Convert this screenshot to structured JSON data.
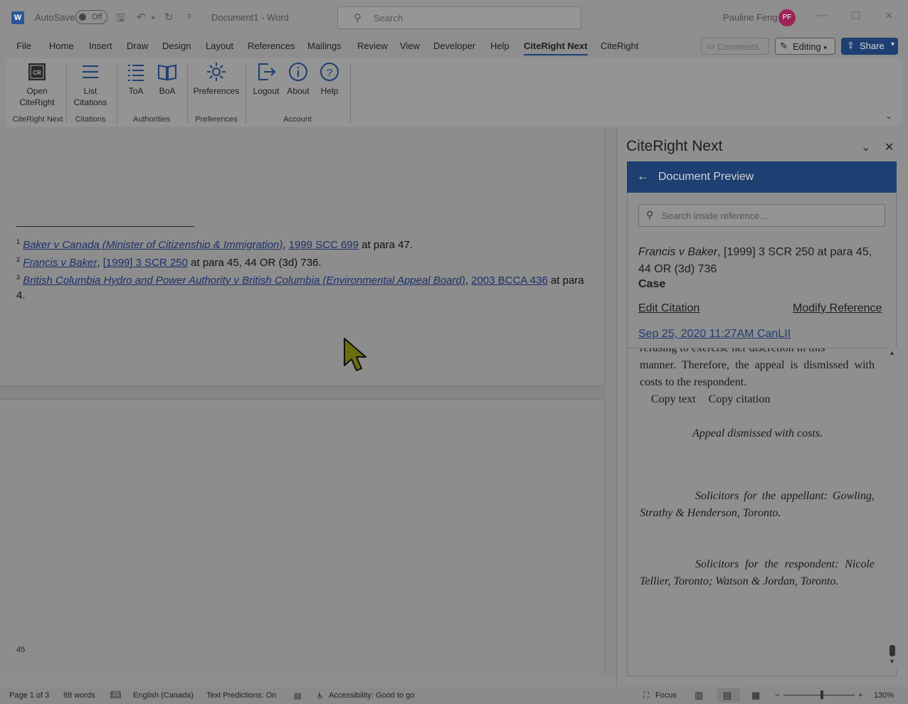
{
  "titlebar": {
    "app_logo": "W",
    "autosave_label": "AutoSave",
    "autosave_state": "Off",
    "doc_title": "Document1  -  Word",
    "search_placeholder": "Search",
    "user_name": "Pauline Feng",
    "user_initials": "PF",
    "icons": [
      "save-icon",
      "undo-icon",
      "redo-icon",
      "customize-icon",
      "minimize-icon",
      "restore-icon",
      "close-icon"
    ]
  },
  "tabs": [
    "File",
    "Home",
    "Insert",
    "Draw",
    "Design",
    "Layout",
    "References",
    "Mailings",
    "Review",
    "View",
    "Developer",
    "Help",
    "CiteRight Next",
    "CiteRight"
  ],
  "active_tab": "CiteRight Next",
  "actions": {
    "comments": "Comments",
    "editing": "Editing",
    "share": "Share"
  },
  "ribbon": {
    "buttons": {
      "open": "Open CiteRight",
      "open_l1": "Open",
      "open_l2": "CiteRight",
      "list_l1": "List",
      "list_l2": "Citations",
      "toa": "ToA",
      "boa": "BoA",
      "preferences": "Preferences",
      "logout": "Logout",
      "about": "About",
      "help": "Help"
    },
    "groups": {
      "g1": "CiteRight Next",
      "g2": "Citations",
      "g3": "Authorities",
      "g4": "Preferences",
      "g5": "Account"
    }
  },
  "document": {
    "footnotes": [
      {
        "num": "1",
        "case": "Baker v Canada (Minister of Citizenship & Immigration)",
        "sep": ", ",
        "cite": "1999 SCC 699",
        "rest": " at para 47."
      },
      {
        "num": "2",
        "case": "Francis v Baker",
        "sep": ", ",
        "cite": "[1999] 3 SCR 250",
        "rest": " at para 45, 44 OR (3d) 736."
      },
      {
        "num": "3",
        "case": "British Columbia Hydro and Power Authority v British Columbia (Environmental Appeal Board)",
        "sep": ", ",
        "cite": "2003 BCCA 436",
        "rest": " at para 4."
      }
    ],
    "page_number": "45"
  },
  "pane": {
    "title": "CiteRight Next",
    "header": "Document Preview",
    "search_placeholder": "Search inside reference...",
    "citation_case": "Francis v Baker",
    "citation_rest": ", [1999] 3 SCR 250 at para 45, 44 OR (3d) 736",
    "ref_type": "Case",
    "edit_citation": "Edit Citation",
    "modify_reference": "Modify Reference",
    "source_date": "Sep 25, 2020 11:27AM CanLII",
    "preview": {
      "cut_line": "refusing to exercise her discretion in this",
      "para": "manner.  Therefore, the appeal is dismissed with costs to the respondent.",
      "copy_text": "Copy text",
      "copy_citation": "Copy citation",
      "disposition": "Appeal dismissed with costs.",
      "solicitors_appellant": "Solicitors for the appellant:  Gowling, Strathy & Henderson, Toronto.",
      "solicitors_respondent": "Solicitors for the respondent:  Nicole Tellier, Toronto; Watson & Jordan, Toronto."
    }
  },
  "status": {
    "page": "Page 1 of 3",
    "words": "88 words",
    "language": "English (Canada)",
    "predictions": "Text Predictions: On",
    "accessibility": "Accessibility: Good to go",
    "focus": "Focus",
    "zoom_minus": "−",
    "zoom_plus": "+",
    "zoom": "130%"
  }
}
